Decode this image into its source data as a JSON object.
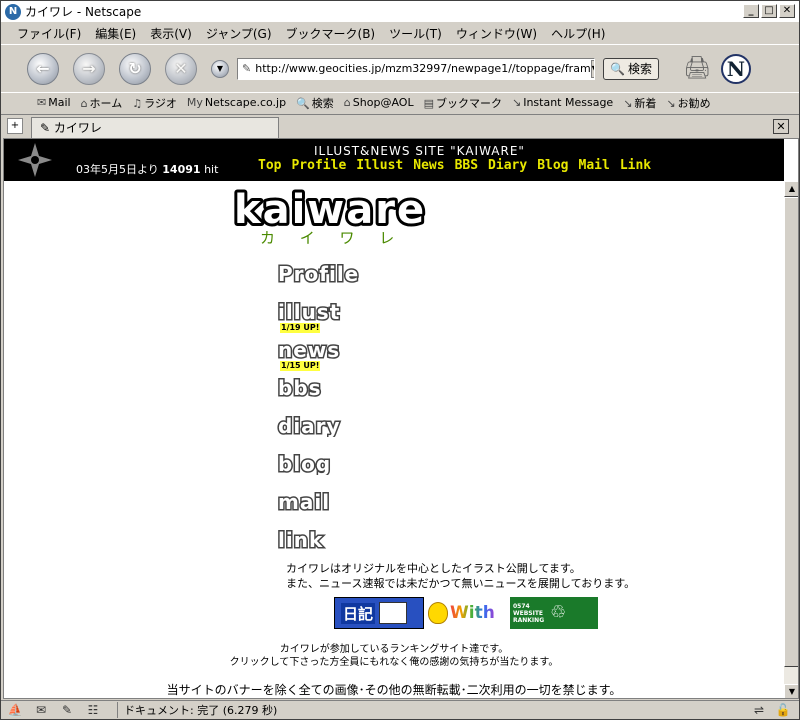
{
  "window": {
    "title": "カイワレ - Netscape",
    "app_icon": "N",
    "minimize": "_",
    "maximize": "□",
    "close": "✕"
  },
  "menu": [
    "ファイル(F)",
    "編集(E)",
    "表示(V)",
    "ジャンプ(G)",
    "ブックマーク(B)",
    "ツール(T)",
    "ウィンドウ(W)",
    "ヘルプ(H)"
  ],
  "navbar": {
    "back_icon": "back-arrow-icon",
    "url": "http://www.geocities.jp/mzm32997/newpage1//toppage/fram",
    "search_label": "検索",
    "logo_letter": "N"
  },
  "personal_toolbar": [
    {
      "icon": "✉",
      "label": "Mail"
    },
    {
      "icon": "⌂",
      "label": "ホーム"
    },
    {
      "icon": "♫",
      "label": "ラジオ"
    },
    {
      "icon": "My",
      "label": "Netscape.co.jp"
    },
    {
      "icon": "🔍",
      "label": "検索"
    },
    {
      "icon": "⌂",
      "label": "Shop@AOL"
    },
    {
      "icon": "▤",
      "label": "ブックマーク"
    },
    {
      "icon": "↘",
      "label": "Instant Message"
    },
    {
      "icon": "↘",
      "label": "新着"
    },
    {
      "icon": "↘",
      "label": "お勧め"
    }
  ],
  "tab": {
    "label": "カイワレ",
    "close": "✕"
  },
  "site": {
    "title": "ILLUST&NEWS SITE \"KAIWARE\"",
    "date_prefix": "03年5月5日より",
    "hit_count": "14091",
    "hit_suffix": "hit",
    "nav": [
      "Top",
      "Profile",
      "Illust",
      "News",
      "BBS",
      "Diary",
      "Blog",
      "Mail",
      "Link"
    ],
    "logo_text": "kaiware",
    "logo_kana": "カ イ ワ レ",
    "menu": [
      {
        "label": "Profile",
        "update": ""
      },
      {
        "label": "illust",
        "update": "1/19 UP!"
      },
      {
        "label": "news",
        "update": "1/15 UP!"
      },
      {
        "label": "bbs",
        "update": ""
      },
      {
        "label": "diary",
        "update": ""
      },
      {
        "label": "blog",
        "update": ""
      },
      {
        "label": "mail",
        "update": ""
      },
      {
        "label": "link",
        "update": ""
      }
    ],
    "desc_line1": "カイワレはオリジナルを中心としたイラスト公開してます。",
    "desc_line2": "また、ニュース速報では未だかつて無いニュースを展開しております。",
    "banner1": "日記",
    "banner2": "With",
    "banner3_lines": [
      "0574",
      "WEBSITE",
      "RANKING"
    ],
    "note_line1": "カイワレが参加しているランキングサイト達です。",
    "note_line2": "クリックして下さった方全員にもれなく俺の感謝の気持ちが当たります。",
    "footer": "当サイトのバナーを除く全ての画像･その他の無断転載･二次利用の一切を禁じます。"
  },
  "status": {
    "text": "ドキュメント: 完了 (6.279 秒)"
  },
  "colors": {
    "header_bg": "#000000",
    "nav_yellow": "#e8e800",
    "update_badge": "#ffff40"
  }
}
